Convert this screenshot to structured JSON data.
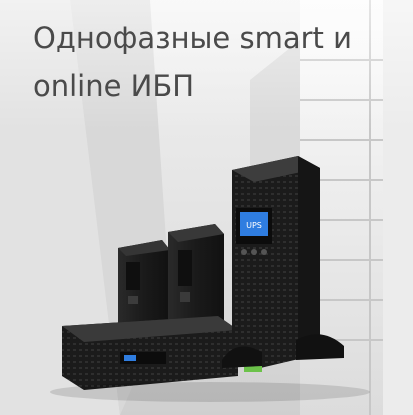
{
  "banner": {
    "title": "Однофазные smart и online ИБП",
    "screen_text": "UPS",
    "colors": {
      "text": "#4a4a4a",
      "device": "#1c1c1c",
      "screen": "#2f7de0",
      "accent": "#6cc24a"
    }
  }
}
